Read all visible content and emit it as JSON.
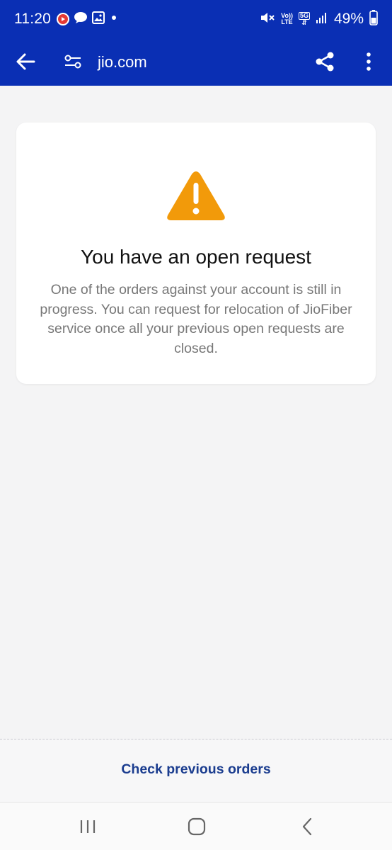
{
  "status_bar": {
    "time": "11:20",
    "battery": "49%",
    "network_top": "Vo))",
    "network_bottom": "LTE",
    "gen": "5G"
  },
  "header": {
    "url": "jio.com",
    "icons": [
      "back-arrow-icon",
      "site-settings-icon",
      "share-icon",
      "more-vert-icon"
    ]
  },
  "card": {
    "icon": "warning-icon",
    "title": "You have an open request",
    "body": "One of the orders against your account is still in progress. You can request for relocation of JioFiber service once all your previous open requests are closed."
  },
  "footer": {
    "link": "Check previous orders"
  },
  "nav": {
    "icons": [
      "recents-icon",
      "home-icon",
      "back-icon"
    ]
  },
  "colors": {
    "header_bg": "#0a2fb4",
    "warning": "#f29a0a",
    "link": "#1b3d8f"
  }
}
